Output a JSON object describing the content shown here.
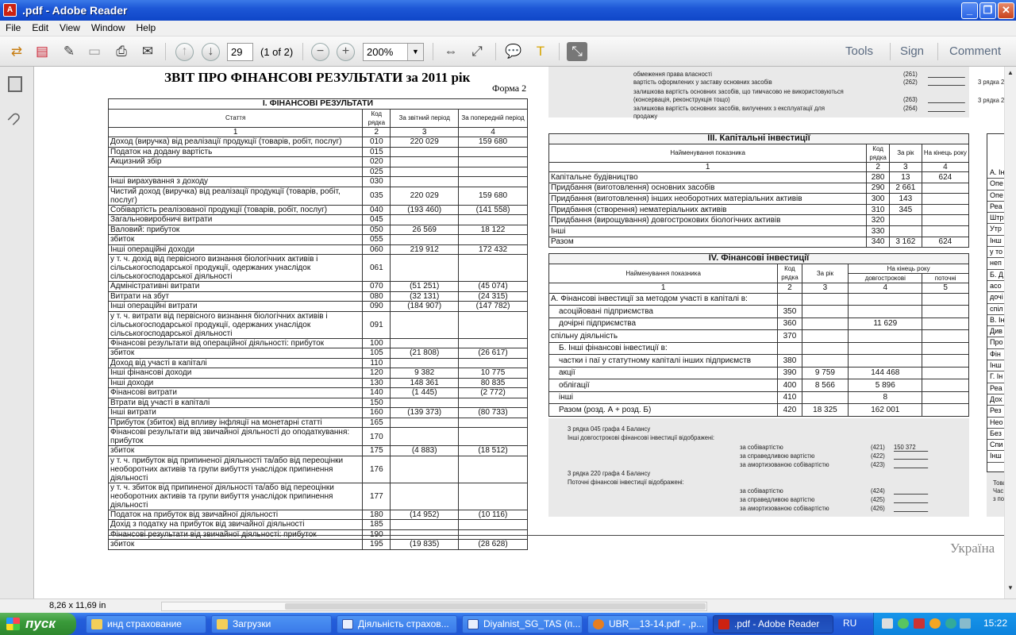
{
  "window": {
    "title": ".pdf - Adobe Reader",
    "min": "_",
    "max": "❐",
    "close": "✕"
  },
  "menu": [
    "File",
    "Edit",
    "View",
    "Window",
    "Help"
  ],
  "toolbar": {
    "page": "29",
    "page_of": "(1 of 2)",
    "zoom": "200%",
    "tools": "Tools",
    "sign": "Sign",
    "comment": "Comment"
  },
  "status": {
    "size": "8,26 x 11,69 in"
  },
  "doc": {
    "title": "ЗВІТ ПРО ФІНАНСОВІ РЕЗУЛЬТАТИ за 2011 рік",
    "form": "Форма 2",
    "section1": "I. ФІНАНСОВІ РЕЗУЛЬТАТИ",
    "h_article": "Стаття",
    "h_code": "Код рядка",
    "h_cur": "За звітний період",
    "h_prev": "За попередній період",
    "h_n": [
      "1",
      "2",
      "3",
      "4"
    ],
    "rows": [
      [
        "Доход (виручка) від реалізації продукції (товарів, робіт, послуг)",
        "010",
        "220 029",
        "159 680"
      ],
      [
        "Податок на додану вартість",
        "015",
        "",
        ""
      ],
      [
        "Акцизний збір",
        "020",
        "",
        ""
      ],
      [
        "",
        "025",
        "",
        ""
      ],
      [
        "Інші вирахування з доходу",
        "030",
        "",
        ""
      ],
      [
        "Чистий доход (виручка) від реалізації продукції (товарів, робіт, послуг)",
        "035",
        "220 029",
        "159 680"
      ],
      [
        "Собівартість реалізованої продукції (товарів, робіт, послуг)",
        "040",
        "(193 460)",
        "(141 558)"
      ],
      [
        "Загальновиробничі витрати",
        "045",
        "",
        ""
      ],
      [
        "Валовий: прибуток",
        "050",
        "26 569",
        "18 122"
      ],
      [
        "збиток",
        "055",
        "",
        ""
      ],
      [
        "Інші операційні доходи",
        "060",
        "219 912",
        "172 432"
      ],
      [
        "у т. ч. дохід від первісного визнання біологічних активів і сільськогосподарської продукції, одержаних унаслідок сільськогосподарської діяльності",
        "061",
        "",
        ""
      ],
      [
        "Адміністративні витрати",
        "070",
        "(51 251)",
        "(45 074)"
      ],
      [
        "Витрати на збут",
        "080",
        "(32 131)",
        "(24 315)"
      ],
      [
        "Інші операційні витрати",
        "090",
        "(184 907)",
        "(147 782)"
      ],
      [
        "у т. ч. витрати від первісного визнання біологічних активів і сільськогосподарської продукції, одержаних унаслідок сільськогосподарської діяльності",
        "091",
        "",
        ""
      ],
      [
        "Фінансові результати від операційної діяльності: прибуток",
        "100",
        "",
        ""
      ],
      [
        "збиток",
        "105",
        "(21 808)",
        "(26 617)"
      ],
      [
        "Доход від участі в капіталі",
        "110",
        "",
        ""
      ],
      [
        "Інші фінансові доходи",
        "120",
        "9 382",
        "10 775"
      ],
      [
        "Інші доходи",
        "130",
        "148 361",
        "80 835"
      ],
      [
        "Фінансові витрати",
        "140",
        "(1 445)",
        "(2 772)"
      ],
      [
        "Втрати від участі в капіталі",
        "150",
        "",
        ""
      ],
      [
        "Інші витрати",
        "160",
        "(139 373)",
        "(80 733)"
      ],
      [
        "Прибуток (збиток) від впливу інфляції на монетарні статті",
        "165",
        "",
        ""
      ],
      [
        "Фінансові результати від звичайної діяльності до оподаткування: прибуток",
        "170",
        "",
        ""
      ],
      [
        "збиток",
        "175",
        "(4 883)",
        "(18 512)"
      ],
      [
        "у т. ч. прибуток від припиненої діяльності та/або від переоцінки необоротних активів та групи вибуття унаслідок припинення діяльності",
        "176",
        "",
        ""
      ],
      [
        "у т. ч. збиток від припиненої діяльності та/або від переоцінки необоротних активів та групи вибуття унаслідок припинення діяльності",
        "177",
        "",
        ""
      ],
      [
        "Податок на прибуток від звичайної діяльності",
        "180",
        "(14 952)",
        "(10 116)"
      ],
      [
        "Дохід з податку на прибуток від звичайної діяльності",
        "185",
        "",
        ""
      ],
      [
        "Фінансові результати від звичайної діяльності: прибуток",
        "190",
        "",
        ""
      ],
      [
        "збиток",
        "195",
        "(19 835)",
        "(28 628)"
      ]
    ],
    "top_right": [
      [
        "обмеження права власності",
        "(261)"
      ],
      [
        "вартість оформлених у заставу основних засобів",
        "(262)"
      ],
      [
        "залишкова вартість основних засобів, що тимчасово не використовуються (консервація, реконструкція тощо)",
        "(263)"
      ],
      [
        "залишкова вартість основних засобів, вилучених з експлуатації для продажу",
        "(264)"
      ]
    ],
    "top_right_side": [
      "3 рядка 2",
      "3 рядка 2"
    ],
    "section3": "III. Капітальні інвестиції",
    "s3_h": [
      "Найменування показника",
      "Код рядка",
      "За рік",
      "На кінець року"
    ],
    "s3_n": [
      "1",
      "2",
      "3",
      "4"
    ],
    "s3_rows": [
      [
        "Капітальне будівництво",
        "280",
        "13",
        "624"
      ],
      [
        "Придбання (виготовлення) основних засобів",
        "290",
        "2 661",
        ""
      ],
      [
        "Придбання (виготовлення) інших необоротних матеріальних активів",
        "300",
        "143",
        ""
      ],
      [
        "Придбання (створення) нематеріальних активів",
        "310",
        "345",
        ""
      ],
      [
        "Придбання (вирощування) довгострокових біологічних активів",
        "320",
        "",
        ""
      ],
      [
        "Інші",
        "330",
        "",
        ""
      ],
      [
        "Разом",
        "340",
        "3 162",
        "624"
      ]
    ],
    "section4": "IV. Фінансові інвестиції",
    "s4_h": [
      "Найменування показника",
      "Код рядка",
      "За рік",
      "На кінець року",
      "довгострокові",
      "поточні"
    ],
    "s4_n": [
      "1",
      "2",
      "3",
      "4",
      "5"
    ],
    "s4_rows": [
      [
        "А. Фінансові інвестиції за методом участі в капіталі в:",
        "",
        "",
        "",
        ""
      ],
      [
        "асоційовані підприємства",
        "350",
        "",
        "",
        ""
      ],
      [
        "дочірні підприємства",
        "360",
        "",
        "11 629",
        ""
      ],
      [
        "спільну діяльність",
        "370",
        "",
        "",
        ""
      ],
      [
        "Б. Інші фінансові інвестиції в:",
        "",
        "",
        "",
        ""
      ],
      [
        "частки і паї у статутному капіталі інших підприємств",
        "380",
        "",
        "",
        ""
      ],
      [
        "акції",
        "390",
        "9 759",
        "144 468",
        ""
      ],
      [
        "облігації",
        "400",
        "8 566",
        "5 896",
        ""
      ],
      [
        "інші",
        "410",
        "",
        "8",
        ""
      ],
      [
        "Разом (розд. А + розд. Б)",
        "420",
        "18 325",
        "162 001",
        ""
      ]
    ],
    "notes": {
      "n1": "3 рядка 045 графа 4 Балансу",
      "n2": "Інші довгострокові фінансові інвестиції відображені:",
      "a1": "за собівартістю",
      "c1": "(421)",
      "v1": "150 372",
      "a2": "за справедливою вартістю",
      "c2": "(422)",
      "a3": "за амортизованою собівартістю",
      "c3": "(423)",
      "n3": "3 рядка 220 графа 4 Балансу",
      "n4": "Поточні фінансові інвестиції відображені:",
      "a4": "за собівартістю",
      "c4": "(424)",
      "a5": "за справедливою вартістю",
      "c5": "(425)",
      "a6": "за амортизованою собівартістю",
      "c6": "(426)"
    },
    "right_col": [
      "А. Ін",
      "Опе",
      "Опе",
      "Реа",
      "Штр",
      "Утр",
      "Інш",
      "у то",
      "неп",
      "Б. Д",
      "асо",
      "дочі",
      "спіл",
      "В. Ін",
      "Див",
      "Про",
      "Фін",
      "Інш",
      "Г. Ін",
      "Реа",
      "Дох",
      "Рез",
      "Нео",
      "Без",
      "Спи",
      "Інш"
    ],
    "right_notes": [
      "Това",
      "Час",
      "з по"
    ],
    "footer": "Україна"
  },
  "taskbar": {
    "start": "пуск",
    "items": [
      "инд страхование",
      "Загрузки",
      "Діяльність страхов...",
      "Diyalnist_SG_TAS (п...",
      "UBR__13-14.pdf - ,р...",
      ".pdf - Adobe Reader"
    ],
    "lang": "RU",
    "time": "15:22"
  }
}
